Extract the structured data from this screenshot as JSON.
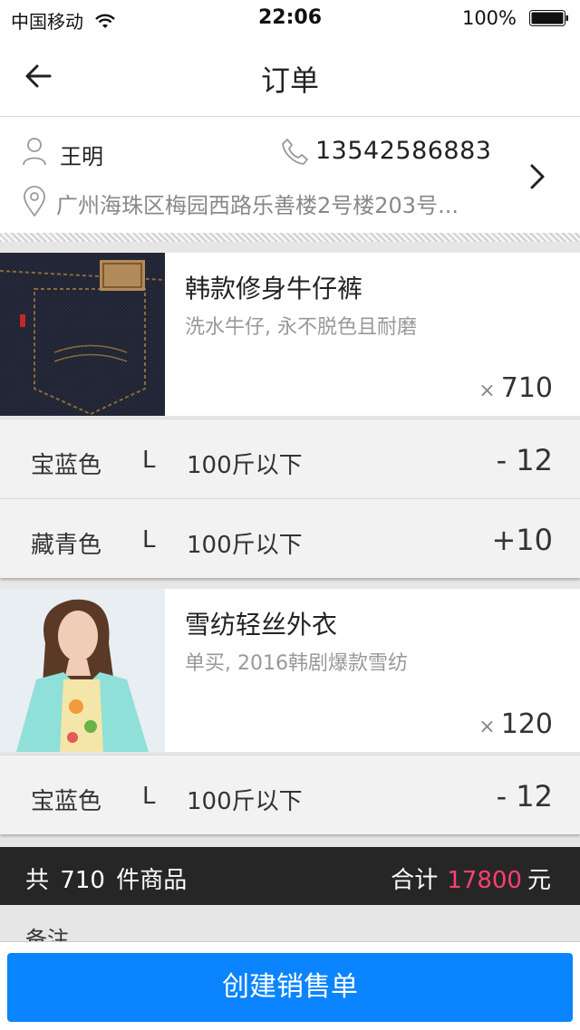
{
  "status_bar": {
    "carrier": "中国移动",
    "time": "22:06",
    "battery": "100%"
  },
  "nav": {
    "title": "订单"
  },
  "address": {
    "name": "王明",
    "phone": "13542586883",
    "address": "广州海珠区梅园西路乐善楼2号楼203号..."
  },
  "products": [
    {
      "name": "韩款修身牛仔裤",
      "desc": "洗水牛仔, 永不脱色且耐磨",
      "qty": "710",
      "variants": [
        {
          "color": "宝蓝色",
          "size": "L",
          "weight": "100斤以下",
          "delta": "- 12"
        },
        {
          "color": "藏青色",
          "size": "L",
          "weight": "100斤以下",
          "delta": "+10"
        }
      ]
    },
    {
      "name": "雪纺轻丝外衣",
      "desc": "单买, 2016韩剧爆款雪纺",
      "qty": "120",
      "variants": [
        {
          "color": "宝蓝色",
          "size": "L",
          "weight": "100斤以下",
          "delta": "- 12"
        }
      ]
    }
  ],
  "summary": {
    "count_prefix": "共",
    "count": "710",
    "count_suffix": "件商品",
    "total_label": "合计",
    "total": "17800",
    "currency": "元",
    "accent_color": "#ff3f72"
  },
  "remark_label": "备注",
  "cta_label": "创建销售单",
  "icons": {
    "back": "back-arrow-icon",
    "person": "person-icon",
    "phone": "phone-icon",
    "pin": "location-pin-icon",
    "chevron": "chevron-right-icon",
    "wifi": "wifi-icon",
    "battery": "battery-icon"
  }
}
